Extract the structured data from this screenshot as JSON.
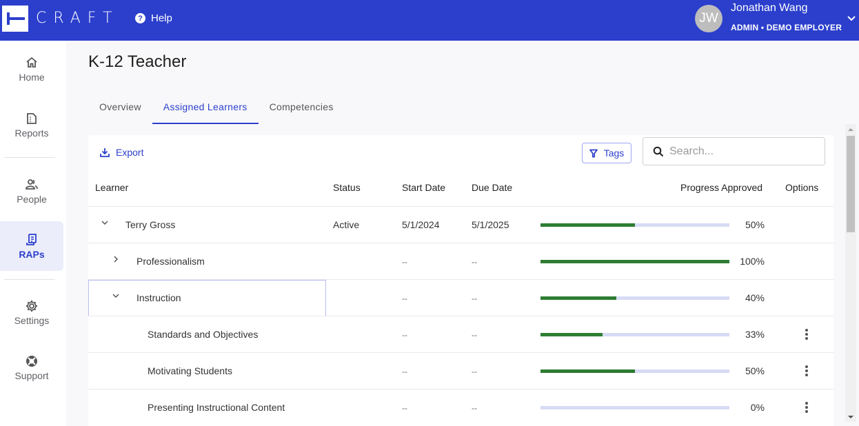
{
  "header": {
    "logo_text": "CRAFT",
    "help_label": "Help",
    "user": {
      "initials": "JW",
      "name": "Jonathan Wang",
      "role": "ADMIN • DEMO EMPLOYER"
    }
  },
  "sidebar": {
    "items": [
      {
        "label": "Home",
        "icon": "home-icon"
      },
      {
        "label": "Reports",
        "icon": "report-icon"
      },
      {
        "label": "People",
        "icon": "people-icon"
      },
      {
        "label": "RAPs",
        "icon": "raps-icon",
        "active": true
      },
      {
        "label": "Settings",
        "icon": "gear-icon"
      },
      {
        "label": "Support",
        "icon": "support-icon"
      }
    ]
  },
  "page": {
    "title": "K-12 Teacher",
    "tabs": [
      {
        "label": "Overview"
      },
      {
        "label": "Assigned Learners",
        "active": true
      },
      {
        "label": "Competencies"
      }
    ]
  },
  "toolbar": {
    "export_label": "Export",
    "tags_label": "Tags",
    "search_placeholder": "Search...",
    "search_value": ""
  },
  "table": {
    "columns": [
      "Learner",
      "Status",
      "Start Date",
      "Due Date",
      "Progress Approved",
      "Options"
    ],
    "rows": [
      {
        "name": "Terry Gross",
        "level": 0,
        "expand": "expanded",
        "status": "Active",
        "start": "5/1/2024",
        "due": "5/1/2025",
        "progress": 50,
        "progress_label": "50%",
        "options": false
      },
      {
        "name": "Professionalism",
        "level": 1,
        "expand": "collapsed",
        "status": "",
        "start": "--",
        "due": "--",
        "progress": 100,
        "progress_label": "100%",
        "options": false
      },
      {
        "name": "Instruction",
        "level": 1,
        "expand": "expanded",
        "status": "",
        "start": "--",
        "due": "--",
        "progress": 40,
        "progress_label": "40%",
        "options": false,
        "focused": true
      },
      {
        "name": "Standards and Objectives",
        "level": 2,
        "expand": "none",
        "status": "",
        "start": "--",
        "due": "--",
        "progress": 33,
        "progress_label": "33%",
        "options": true
      },
      {
        "name": "Motivating Students",
        "level": 2,
        "expand": "none",
        "status": "",
        "start": "--",
        "due": "--",
        "progress": 50,
        "progress_label": "50%",
        "options": true
      },
      {
        "name": "Presenting Instructional Content",
        "level": 2,
        "expand": "none",
        "status": "",
        "start": "--",
        "due": "--",
        "progress": 0,
        "progress_label": "0%",
        "options": true
      }
    ]
  },
  "colors": {
    "brand": "#2b3fcc",
    "progress_fill": "#2e7d32",
    "progress_track": "#d7dbf4"
  }
}
